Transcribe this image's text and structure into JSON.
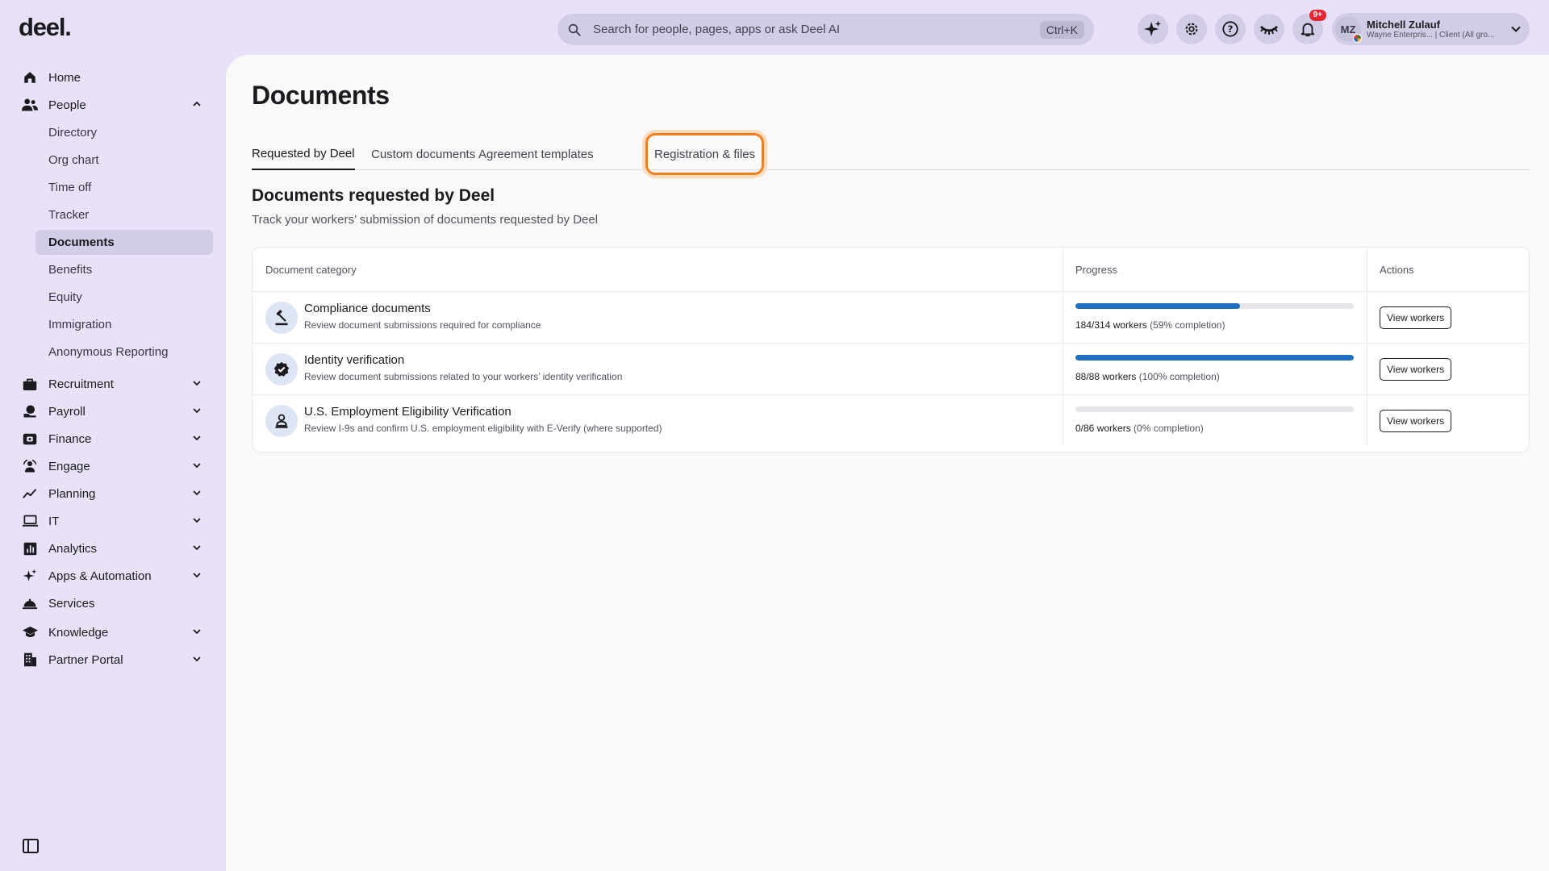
{
  "brand": {
    "logo": "deel."
  },
  "search": {
    "placeholder": "Search for people, pages, apps or ask Deel AI",
    "shortcut": "Ctrl+K"
  },
  "header": {
    "notifications_badge": "9+",
    "user": {
      "initials": "MZ",
      "name": "Mitchell Zulauf",
      "subtitle": "Wayne Enterpris... | Client (All gro..."
    }
  },
  "sidebar": {
    "items": [
      {
        "label": "Home",
        "icon": "home-icon"
      },
      {
        "label": "People",
        "icon": "people-icon",
        "expanded": true,
        "children": [
          "Directory",
          "Org chart",
          "Time off",
          "Tracker",
          "Documents",
          "Benefits",
          "Equity",
          "Immigration",
          "Anonymous Reporting"
        ]
      },
      {
        "label": "Recruitment",
        "icon": "briefcase-icon"
      },
      {
        "label": "Payroll",
        "icon": "payroll-icon"
      },
      {
        "label": "Finance",
        "icon": "finance-icon"
      },
      {
        "label": "Engage",
        "icon": "engage-icon"
      },
      {
        "label": "Planning",
        "icon": "trend-icon"
      },
      {
        "label": "IT",
        "icon": "laptop-icon"
      },
      {
        "label": "Analytics",
        "icon": "analytics-icon"
      },
      {
        "label": "Apps & Automation",
        "icon": "sparkle-icon"
      },
      {
        "label": "Services",
        "icon": "bell-service-icon"
      },
      {
        "label": "Knowledge",
        "icon": "graduation-cap-icon"
      },
      {
        "label": "Partner Portal",
        "icon": "building-icon"
      }
    ],
    "active_child": "Documents"
  },
  "page": {
    "title": "Documents",
    "tabs": [
      "Requested by Deel",
      "Custom documents",
      "Agreement templates",
      "Registration & files"
    ],
    "active_tab": "Requested by Deel",
    "focused_tab": "Registration & files",
    "section_title": "Documents requested by Deel",
    "section_subtitle": "Track your workers’ submission of documents requested by Deel"
  },
  "table": {
    "headers": [
      "Document category",
      "Progress",
      "Actions"
    ],
    "rows": [
      {
        "title": "Compliance documents",
        "description": "Review document submissions required for compliance",
        "progress_count": "184/314 workers",
        "progress_pct": "(59% completion)",
        "progress_fraction": 0.59,
        "action": "View workers",
        "icon": "gavel-icon"
      },
      {
        "title": "Identity verification",
        "description": "Review document submissions related to your workers’ identity verification",
        "progress_count": "88/88 workers",
        "progress_pct": "(100% completion)",
        "progress_fraction": 1.0,
        "action": "View workers",
        "icon": "verified-badge-icon"
      },
      {
        "title": "U.S. Employment Eligibility Verification",
        "description": "Review I-9s and confirm U.S. employment eligibility with E-Verify (where supported)",
        "progress_count": "0/86 workers",
        "progress_pct": "(0% completion)",
        "progress_fraction": 0.0,
        "action": "View workers",
        "icon": "person-stamp-icon"
      }
    ]
  },
  "colors": {
    "accent": "#1f6fbf",
    "focus_ring": "#f07f1f",
    "sidebar_bg": "#e8e1f7",
    "badge": "#e3262f"
  }
}
